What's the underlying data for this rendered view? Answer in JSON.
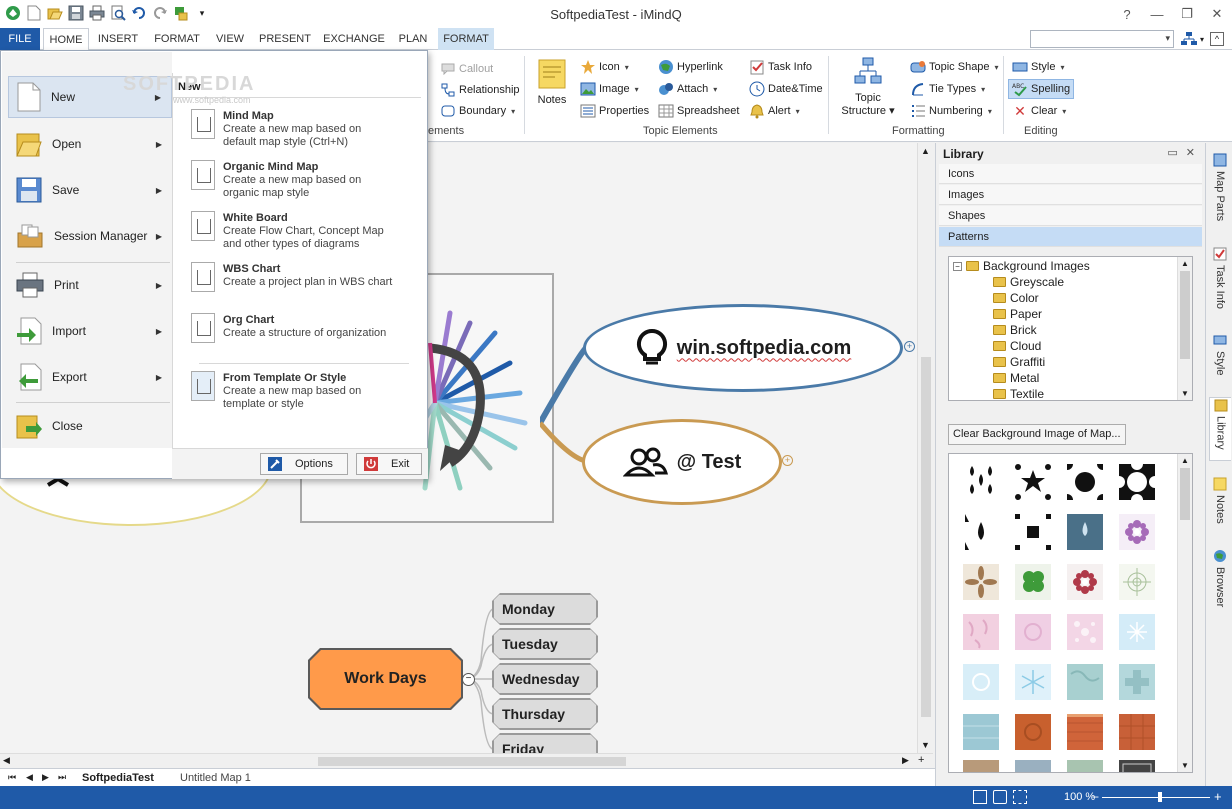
{
  "app": {
    "title": "SoftpediaTest - iMindQ"
  },
  "qat": {
    "icons": [
      "app-logo-icon",
      "new-doc-icon",
      "open-icon",
      "save-icon",
      "print-icon",
      "print-preview-icon",
      "undo-icon",
      "redo-icon",
      "paint-icon",
      "customize-icon"
    ]
  },
  "tabs": {
    "file": "FILE",
    "home": "HOME",
    "insert": "INSERT",
    "format": "FORMAT",
    "view": "VIEW",
    "present": "PRESENT",
    "exchange": "EXCHANGE",
    "plan": "PLAN",
    "format_ctx": "FORMAT"
  },
  "ribbon": {
    "elements_partial": "ements",
    "callout": "Callout",
    "relationship": "Relationship",
    "boundary": "Boundary",
    "notes": "Notes",
    "icon": "Icon",
    "image": "Image",
    "properties": "Properties",
    "hyperlink": "Hyperlink",
    "attach": "Attach",
    "spreadsheet": "Spreadsheet",
    "task_info": "Task Info",
    "date_time": "Date&Time",
    "alert": "Alert",
    "topic_elements": "Topic Elements",
    "topic_structure_1": "Topic",
    "topic_structure_2": "Structure",
    "topic_shape": "Topic Shape",
    "tie_types": "Tie Types",
    "numbering": "Numbering",
    "formatting": "Formatting",
    "style": "Style",
    "spelling": "Spelling",
    "clear": "Clear",
    "editing": "Editing"
  },
  "file_menu": {
    "items": [
      {
        "label": "New",
        "icon": "new-document-icon"
      },
      {
        "label": "Open",
        "icon": "open-folder-icon"
      },
      {
        "label": "Save",
        "icon": "save-disk-icon"
      },
      {
        "label": "Session Manager",
        "icon": "session-box-icon"
      },
      {
        "label": "Print",
        "icon": "printer-icon"
      },
      {
        "label": "Import",
        "icon": "import-arrow-icon"
      },
      {
        "label": "Export",
        "icon": "export-arrow-icon"
      },
      {
        "label": "Close",
        "icon": "close-folder-icon"
      }
    ],
    "submenu_title": "New",
    "options": [
      {
        "title": "Mind Map",
        "desc1": "Create a new map based on",
        "desc2": "default map style (Ctrl+N)"
      },
      {
        "title": "Organic Mind Map",
        "desc1": "Create a new map based on",
        "desc2": "organic map style"
      },
      {
        "title": "White Board",
        "desc1": "Create Flow Chart, Concept Map",
        "desc2": "and other types of diagrams"
      },
      {
        "title": "WBS Chart",
        "desc1": "Create a project plan in WBS chart",
        "desc2": ""
      },
      {
        "title": "Org Chart",
        "desc1": "Create a structure of organization",
        "desc2": ""
      },
      {
        "title": "From Template Or Style",
        "desc1": "Create a new map based on",
        "desc2": "template or style"
      }
    ],
    "options_button": "Options",
    "exit_button": "Exit"
  },
  "watermark": {
    "brand": "SOFTPEDIA",
    "url": "www.softpedia.com"
  },
  "canvas": {
    "topic_softpedia": "win.softpedia.com",
    "topic_test": "@ Test",
    "central": "Work Days",
    "days": [
      "Monday",
      "Tuesday",
      "Wednesday",
      "Thursday",
      "Friday"
    ]
  },
  "sheets": {
    "active": "SoftpediaTest",
    "inactive": "Untitled Map 1"
  },
  "status": {
    "zoom": "100 %"
  },
  "library": {
    "title": "Library",
    "sections": [
      "Icons",
      "Images",
      "Shapes",
      "Patterns"
    ],
    "tree_root": "Background Images",
    "tree_items": [
      "Greyscale",
      "Color",
      "Paper",
      "Brick",
      "Cloud",
      "Graffiti",
      "Metal",
      "Textile"
    ],
    "clear_button": "Clear Background Image of Map..."
  },
  "side_tabs": [
    "Map Parts",
    "Task Info",
    "Style",
    "Library",
    "Notes",
    "Browser"
  ],
  "colors": {
    "accent": "#1f5aa8",
    "ctx_tab": "#cfe2f3",
    "topic_blue": "#4a7aa8",
    "topic_tan": "#c99a52",
    "central": "#ff9a4a",
    "selection": "#c5dcf5"
  }
}
